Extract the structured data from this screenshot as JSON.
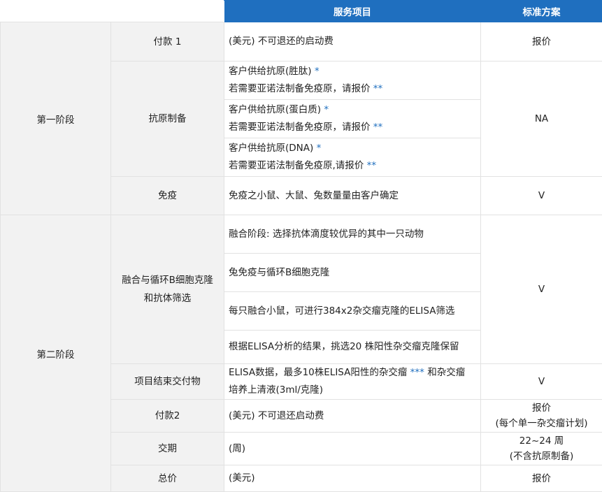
{
  "header": {
    "col3": "服务项目",
    "col4": "标准方案"
  },
  "stage1": {
    "label": "第一阶段",
    "rows": {
      "payment1": {
        "item": "付款 1",
        "service": "(美元) 不可退还的启动费",
        "plan": "报价"
      },
      "antigen": {
        "item": "抗原制备",
        "subrows": [
          {
            "line1": "客户供给抗原(胜肽) ",
            "star1": "*",
            "line2": "若需要亚诺法制备免疫原，请报价 ",
            "star2": "**"
          },
          {
            "line1": "客户供给抗原(蛋白质) ",
            "star1": "*",
            "line2": "若需要亚诺法制备免疫原，请报价 ",
            "star2": "**"
          },
          {
            "line1": "客户供给抗原(DNA) ",
            "star1": "*",
            "line2": "若需要亚诺法制备免疫原,请报价 ",
            "star2": "**"
          }
        ],
        "plan": "NA"
      },
      "immunize": {
        "item": "免疫",
        "service": "免疫之小鼠、大鼠、兔数量量由客户确定",
        "plan": "V"
      }
    }
  },
  "stage2": {
    "label": "第二阶段",
    "rows": {
      "fusion": {
        "item_line1": "融合与循环B细胞克隆",
        "item_line2": "和抗体筛选",
        "services": [
          "融合阶段: 选择抗体滴度较优异的其中一只动物",
          "兔免疫与循环B细胞克隆",
          "每只融合小鼠，可进行384x2杂交瘤克隆的ELISA筛选",
          "根据ELISA分析的结果，挑选20 株阳性杂交瘤克隆保留"
        ],
        "plan": "V"
      },
      "deliverable": {
        "item": "项目结束交付物",
        "service_part1": "ELISA数据，最多10株ELISA阳性的杂交瘤 ",
        "service_star": "***",
        "service_part2": " 和杂交瘤",
        "service_line2": "培养上清液(3ml/克隆)",
        "plan": "V"
      },
      "payment2": {
        "item": "付款2",
        "service": "(美元) 不可退还启动费",
        "plan_line1": "报价",
        "plan_line2": "(每个单一杂交瘤计划)"
      },
      "delivery": {
        "item": "交期",
        "service": "(周)",
        "plan_line1": "22~24 周",
        "plan_line2": "(不含抗原制备)"
      },
      "total": {
        "item": "总价",
        "service": "(美元)",
        "plan": "报价"
      }
    }
  },
  "colors": {
    "header_bg": "#1f6fbf",
    "label_bg": "#f2f2f2",
    "star": "#1f6fbf",
    "border": "#e2e2e2"
  }
}
